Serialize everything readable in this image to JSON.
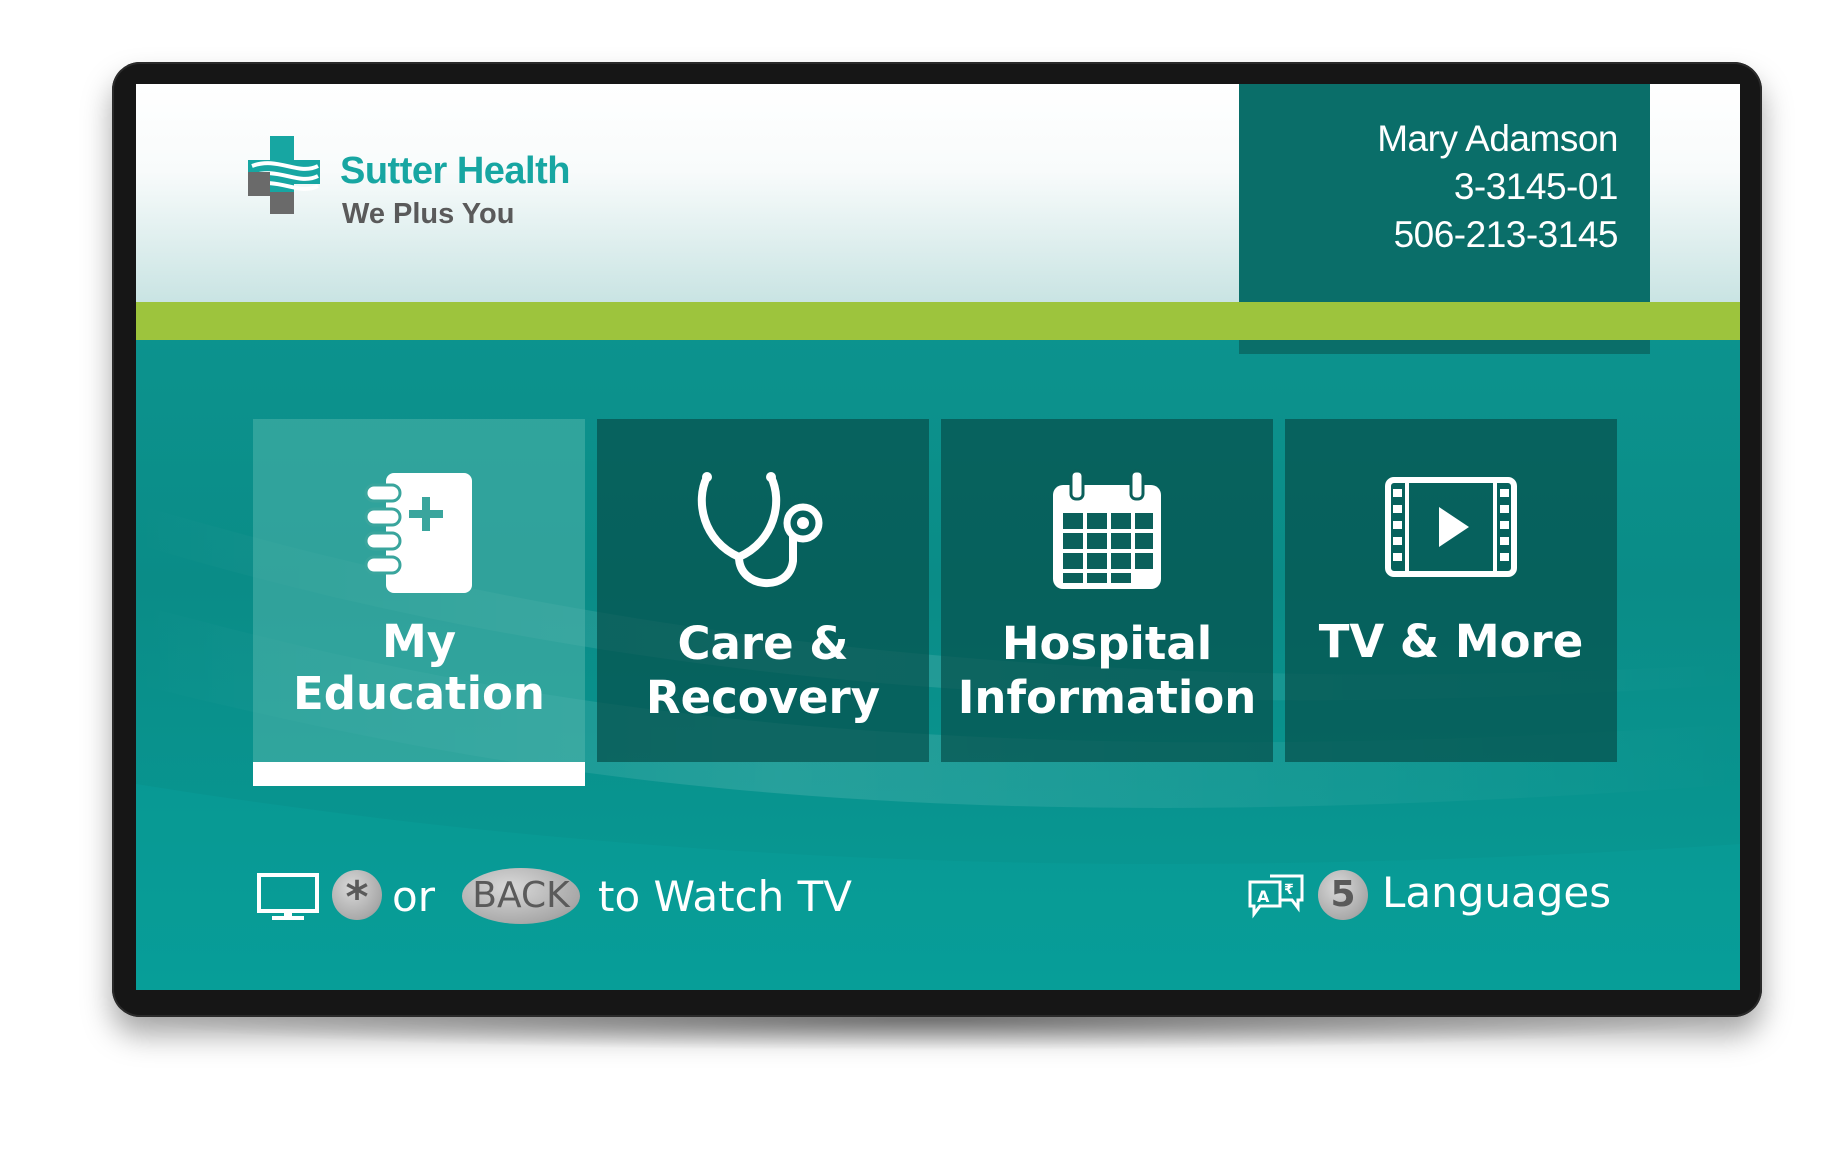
{
  "brand": {
    "name": "Sutter Health",
    "tagline": "We Plus You",
    "colors": {
      "teal": "#17a6a2",
      "dark_teal": "#0a6e69",
      "green_bar": "#9dc43d",
      "screen_teal": "#0a8c87"
    }
  },
  "patient": {
    "name": "Mary Adamson",
    "room": "3-3145-01",
    "phone": "506-213-3145"
  },
  "menu": {
    "selected_index": 0,
    "tiles": [
      {
        "line1": "My",
        "line2": "Education",
        "icon": "notebook-plus-icon"
      },
      {
        "line1": "Care &",
        "line2": "Recovery",
        "icon": "stethoscope-icon"
      },
      {
        "line1": "Hospital",
        "line2": "Information",
        "icon": "calendar-icon"
      },
      {
        "line1": "TV & More",
        "line2": "",
        "icon": "film-play-icon"
      }
    ]
  },
  "footer": {
    "tv_hint": {
      "icon": "tv-icon",
      "star_key": "*",
      "or_text": "or",
      "back_key": "BACK",
      "action_text": "to Watch TV"
    },
    "languages": {
      "icon": "translate-icon",
      "key": "5",
      "label": "Languages"
    }
  }
}
